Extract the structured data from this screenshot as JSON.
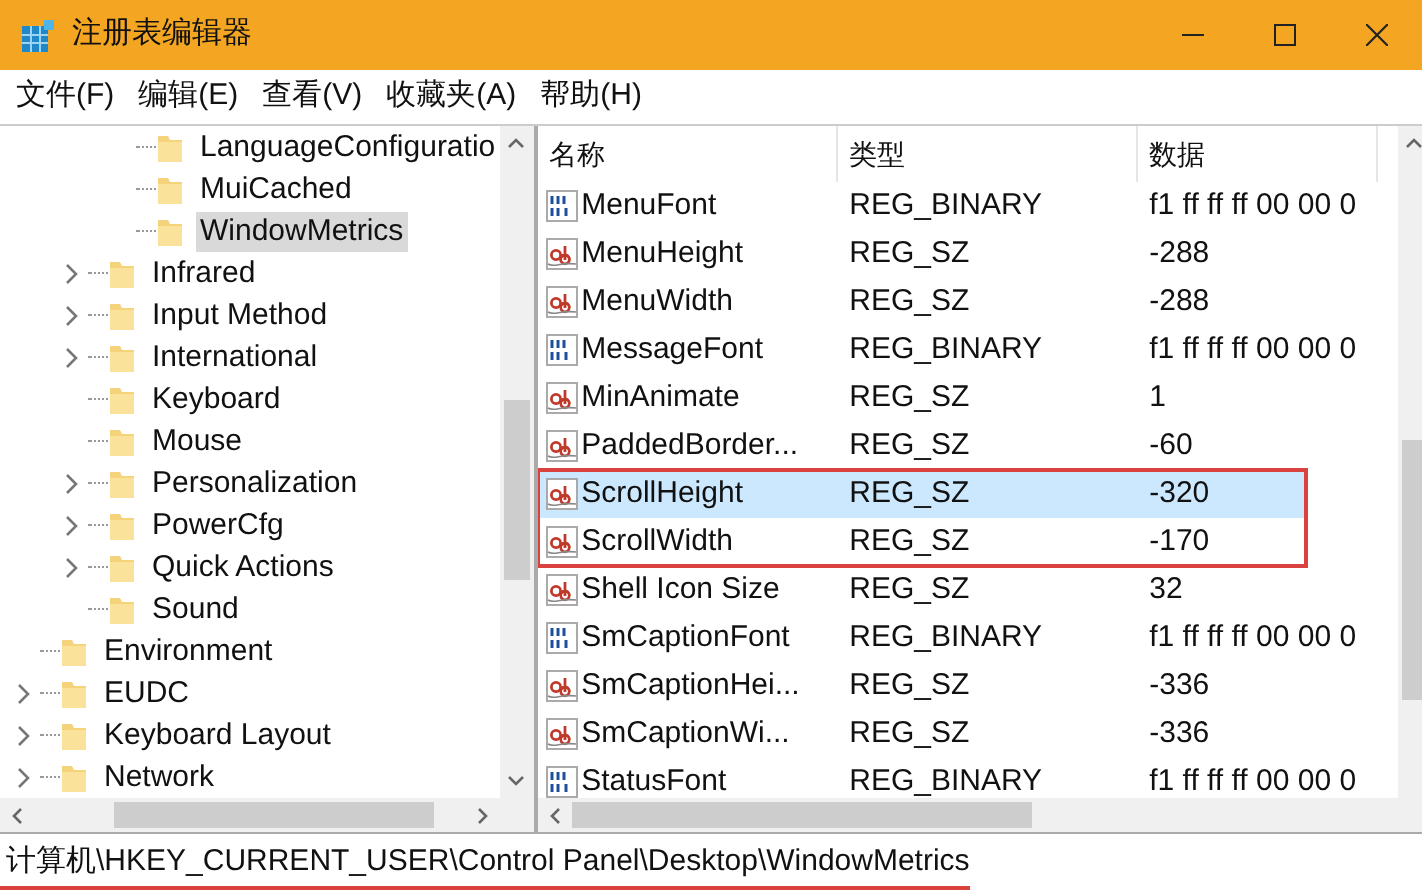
{
  "window": {
    "title": "注册表编辑器"
  },
  "menu": [
    "文件(F)",
    "编辑(E)",
    "查看(V)",
    "收藏夹(A)",
    "帮助(H)"
  ],
  "tree": [
    {
      "children": [
        {
          "children": [
            {
              "label": "LanguageConfiguratio",
              "expandable": false,
              "selected": false
            },
            {
              "label": "MuiCached",
              "expandable": false,
              "selected": false
            },
            {
              "label": "WindowMetrics",
              "expandable": false,
              "selected": true
            }
          ]
        },
        {
          "label": "Infrared",
          "expandable": true,
          "selected": false
        },
        {
          "label": "Input Method",
          "expandable": true,
          "selected": false
        },
        {
          "label": "International",
          "expandable": true,
          "selected": false
        },
        {
          "label": "Keyboard",
          "expandable": false,
          "selected": false
        },
        {
          "label": "Mouse",
          "expandable": false,
          "selected": false
        },
        {
          "label": "Personalization",
          "expandable": true,
          "selected": false
        },
        {
          "label": "PowerCfg",
          "expandable": true,
          "selected": false
        },
        {
          "label": "Quick Actions",
          "expandable": true,
          "selected": false
        },
        {
          "label": "Sound",
          "expandable": false,
          "selected": false
        }
      ]
    },
    {
      "label": "Environment",
      "expandable": false,
      "selected": false
    },
    {
      "label": "EUDC",
      "expandable": true,
      "selected": false
    },
    {
      "label": "Keyboard Layout",
      "expandable": true,
      "selected": false
    },
    {
      "label": "Network",
      "expandable": true,
      "selected": false
    }
  ],
  "table": {
    "columns": [
      "名称",
      "类型",
      "数据"
    ],
    "rows": [
      {
        "kind": "binary",
        "name": "MenuFont",
        "type": "REG_BINARY",
        "data": "f1 ff ff ff 00 00 0",
        "selected": false,
        "annotated": false
      },
      {
        "kind": "string",
        "name": "MenuHeight",
        "type": "REG_SZ",
        "data": "-288",
        "selected": false,
        "annotated": false
      },
      {
        "kind": "string",
        "name": "MenuWidth",
        "type": "REG_SZ",
        "data": "-288",
        "selected": false,
        "annotated": false
      },
      {
        "kind": "binary",
        "name": "MessageFont",
        "type": "REG_BINARY",
        "data": "f1 ff ff ff 00 00 0",
        "selected": false,
        "annotated": false
      },
      {
        "kind": "string",
        "name": "MinAnimate",
        "type": "REG_SZ",
        "data": "1",
        "selected": false,
        "annotated": false
      },
      {
        "kind": "string",
        "name": "PaddedBorder...",
        "type": "REG_SZ",
        "data": "-60",
        "selected": false,
        "annotated": false
      },
      {
        "kind": "string",
        "name": "ScrollHeight",
        "type": "REG_SZ",
        "data": "-320",
        "selected": true,
        "annotated": true
      },
      {
        "kind": "string",
        "name": "ScrollWidth",
        "type": "REG_SZ",
        "data": "-170",
        "selected": false,
        "annotated": true
      },
      {
        "kind": "string",
        "name": "Shell Icon Size",
        "type": "REG_SZ",
        "data": "32",
        "selected": false,
        "annotated": false
      },
      {
        "kind": "binary",
        "name": "SmCaptionFont",
        "type": "REG_BINARY",
        "data": "f1 ff ff ff 00 00 0",
        "selected": false,
        "annotated": false
      },
      {
        "kind": "string",
        "name": "SmCaptionHei...",
        "type": "REG_SZ",
        "data": "-336",
        "selected": false,
        "annotated": false
      },
      {
        "kind": "string",
        "name": "SmCaptionWi...",
        "type": "REG_SZ",
        "data": "-336",
        "selected": false,
        "annotated": false
      },
      {
        "kind": "binary",
        "name": "StatusFont",
        "type": "REG_BINARY",
        "data": "f1 ff ff ff 00 00 0",
        "selected": false,
        "annotated": false
      }
    ]
  },
  "status_bar": {
    "path": "计算机\\HKEY_CURRENT_USER\\Control Panel\\Desktop\\WindowMetrics",
    "underlined": true
  }
}
